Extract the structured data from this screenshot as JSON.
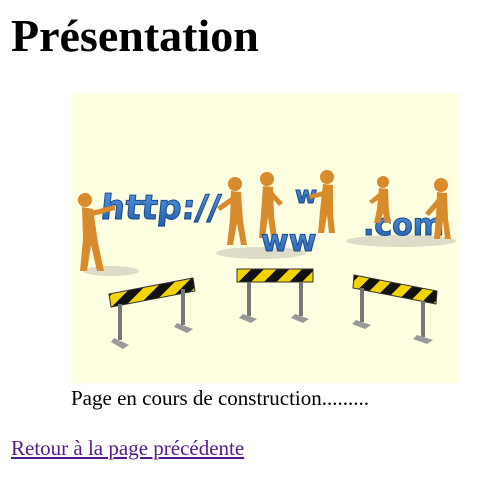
{
  "page": {
    "title": "Présentation",
    "caption": "Page en cours de construction.........",
    "back_link": "Retour à la page précédente"
  },
  "illustration": {
    "texts": {
      "http": "http://",
      "w1": "w",
      "ww": "ww",
      "com": ".com"
    },
    "colors": {
      "background": "#fefee0",
      "letters": "#2f6fbf",
      "figures": "#d98a2a",
      "barrier_stripe": "#f2d400"
    }
  }
}
